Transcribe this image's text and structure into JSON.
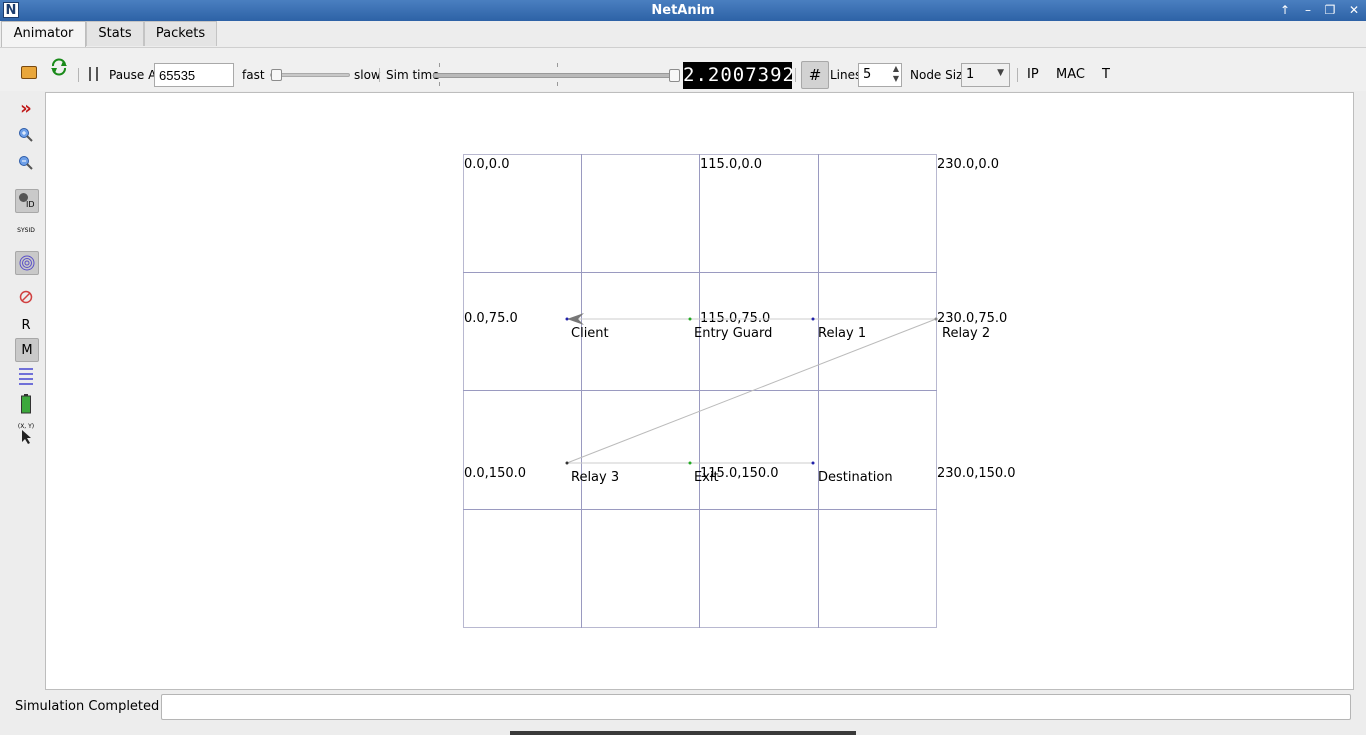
{
  "window": {
    "title": "NetAnim",
    "app_icon_letter": "N"
  },
  "tabs": [
    {
      "label": "Animator",
      "active": true
    },
    {
      "label": "Stats",
      "active": false
    },
    {
      "label": "Packets",
      "active": false
    }
  ],
  "toolbar": {
    "pause_at_label": "Pause At",
    "pause_at_value": "65535",
    "fast_label": "fast",
    "slow_label": "slow",
    "speed_slider_fraction": 0.0,
    "sim_time_label": "Sim time",
    "sim_time_slider_fraction": 1.0,
    "sim_time_value": "2.2007392",
    "lines_label": "Lines",
    "lines_value": "5",
    "node_size_label": "Node Size",
    "node_size_value": "1",
    "ip_label": "IP",
    "mac_label": "MAC",
    "t_label": "T"
  },
  "leftbar": {
    "r_label": "R",
    "m_label": "M",
    "id_label": "ID",
    "sysid_label": "SYSID",
    "xy_label": "(X, Y)"
  },
  "grid": {
    "corner_labels": {
      "tl": "0.0,0.0",
      "tm": "115.0,0.0",
      "tr": "230.0,0.0",
      "ml": "0.0,75.0",
      "mm": "115.0,75.0",
      "mr": "230.0,75.0",
      "bl": "0.0,150.0",
      "bm": "115.0,150.0",
      "br": "230.0,150.0"
    }
  },
  "nodes": [
    {
      "name": "Client",
      "color": "#2222aa"
    },
    {
      "name": "Entry Guard",
      "color": "#22aa22"
    },
    {
      "name": "Relay 1",
      "color": "#2222aa"
    },
    {
      "name": "Relay 2",
      "color": "#888888"
    },
    {
      "name": "Relay 3",
      "color": "#333333"
    },
    {
      "name": "Exit",
      "color": "#22aa22"
    },
    {
      "name": "Destination",
      "color": "#2222aa"
    }
  ],
  "status": {
    "message": "Simulation Completed"
  },
  "colors": {
    "titlebar": "#2d62a6",
    "grid_line": "#9a9ac0",
    "link_line": "#c8c8c8"
  }
}
